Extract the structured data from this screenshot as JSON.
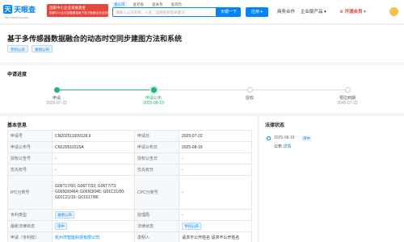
{
  "header": {
    "logo_mark": "天",
    "logo_name": "天眼查",
    "logo_url": "TianYanCha.com",
    "promo_line1": "国家中小企业发展基金",
    "promo_line2": "国家中小企业发展基金旗下官方备案企业征信机构",
    "tabs": [
      "查公司",
      "查老板",
      "查关系",
      "查风险"
    ],
    "search_placeholder": "请输入公司名称、人名、品牌名称等关键词",
    "search_button": "天眼一下",
    "app_button": "应用 ▾",
    "nav_items": [
      "商务合作",
      "企业版产品 ▾"
    ],
    "vip_label": "开通会员 ▾"
  },
  "title": {
    "text": "基于多传感器数据融合的动态时空同步建图方法和系统",
    "tags": [
      "专利公开",
      "发明公布"
    ]
  },
  "progress": {
    "section_title": "申请进度",
    "steps": [
      {
        "label": "申请",
        "date": "2025-07-22",
        "state": "done"
      },
      {
        "label": "申请公布",
        "date": "2025-08-19",
        "state": "current"
      },
      {
        "label": "授权",
        "date": "-",
        "state": "todo"
      },
      {
        "label": "预估到期",
        "date": "2045-07-22",
        "state": "todo"
      }
    ]
  },
  "basic_info": {
    "section_title": "基本信息",
    "rows": [
      [
        "申请号",
        "CN202511009128.9",
        "申请日",
        "2025-07-22"
      ],
      [
        "申请公布号",
        "CN120510315A",
        "申请公布日",
        "2025-08-19"
      ],
      [
        "授权公告号",
        "-",
        "授权公告日",
        "-"
      ],
      [
        "优先权号",
        "-",
        "优先权日",
        "-"
      ]
    ],
    "ipc_label": "IPC分类号",
    "ipc_value": "G06T17/00; G06T7/33; G06T7/73; G06N3/0464; G06N3/045; G01C21/00; G01C21/16; G01S17/86",
    "cpc_label": "CPC分类号",
    "cpc_value": "-",
    "type_label": "专利类型",
    "type_value": "发明公布",
    "agency_label": "授理局",
    "agency_value": "-",
    "status_label": "最新法律状态",
    "status_value": "审中",
    "law_status_label": "法律状态",
    "law_status_value": "专利公开",
    "applicant_label": "申请（专利权）",
    "applicant_value": "杭州市智能科技有限公司",
    "inventor_label": "发明人",
    "inventor_value": "请求不公开姓名 请求不公开姓名"
  },
  "legal_status": {
    "section_title": "法律状态",
    "date": "2025-08-19",
    "badge": "审中",
    "event": "公布",
    "detail_link": "详情"
  },
  "colors": {
    "brand": "#0084ff",
    "done": "#22b573",
    "promo": "#e8453c"
  }
}
